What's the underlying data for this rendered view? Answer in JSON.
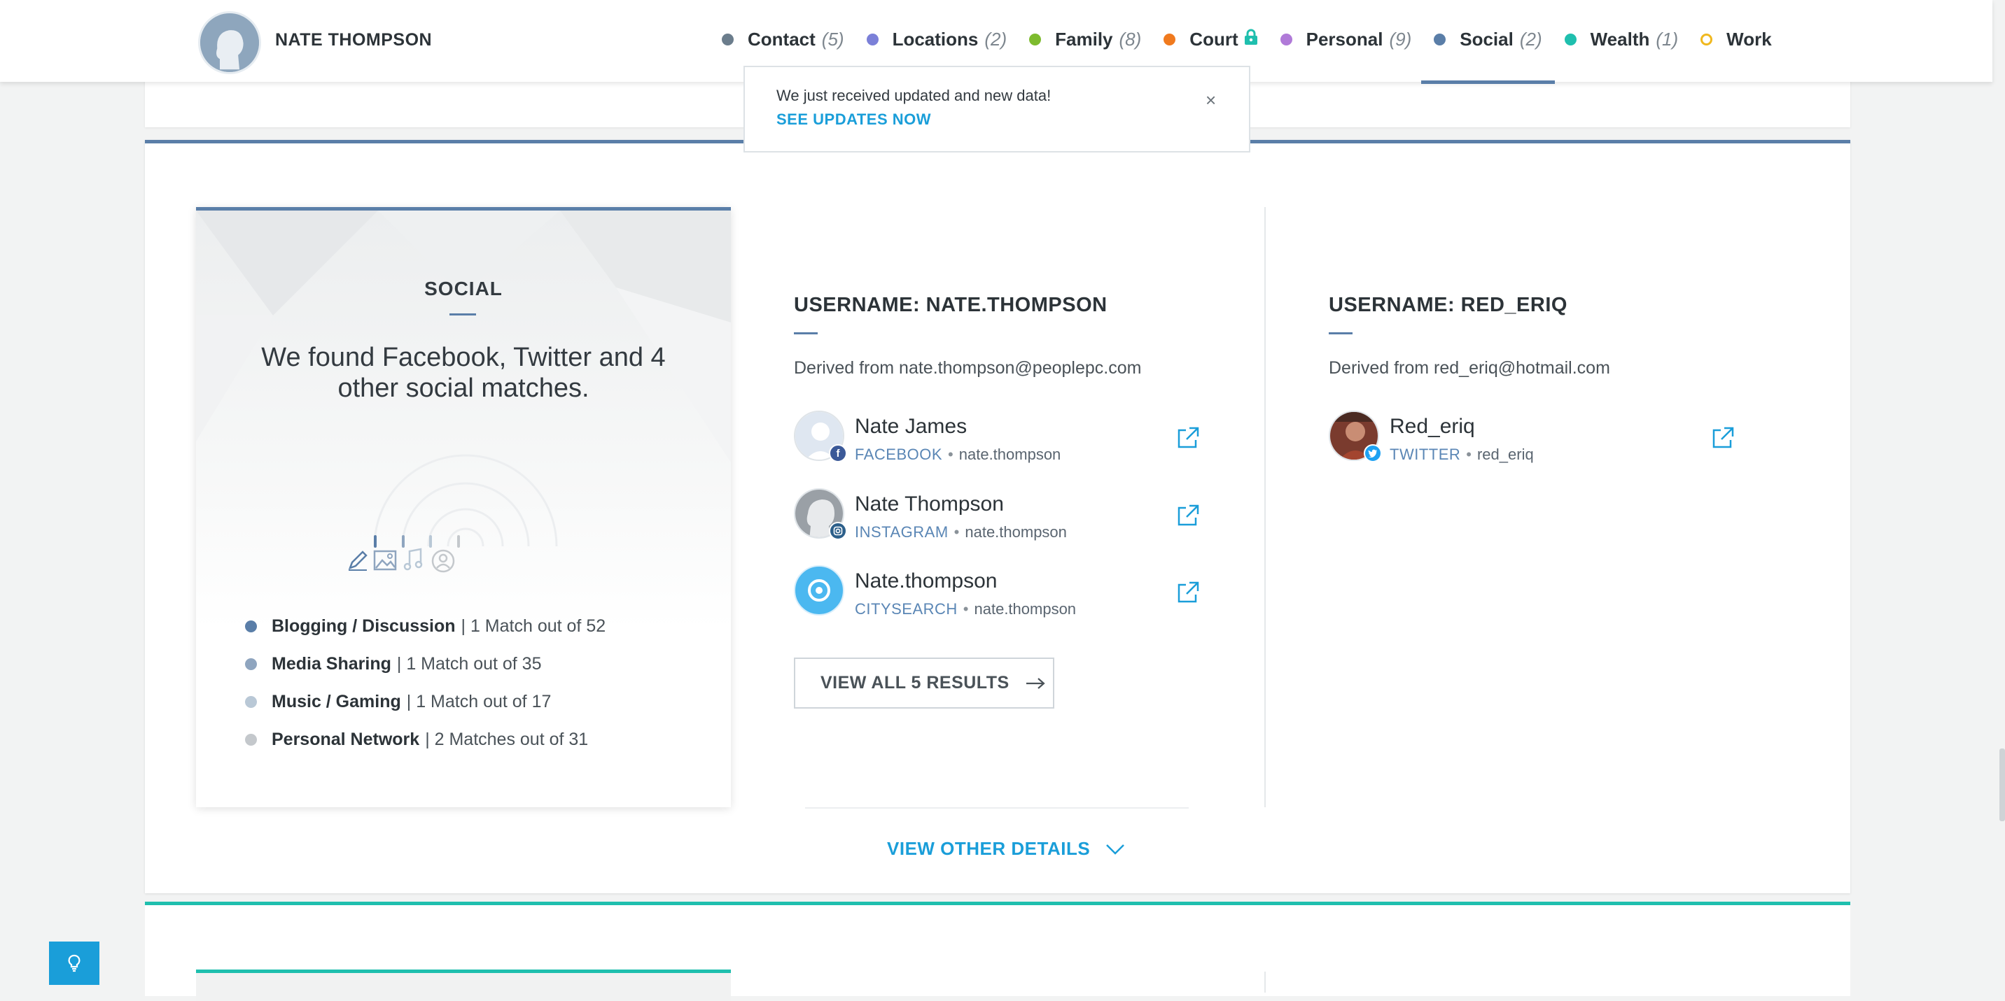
{
  "header": {
    "name": "NATE THOMPSON",
    "nav": [
      {
        "label": "Contact",
        "count": "(5)",
        "color": "#6b7d8c"
      },
      {
        "label": "Locations",
        "count": "(2)",
        "color": "#7b80d8"
      },
      {
        "label": "Family",
        "count": "(8)",
        "color": "#7dbb2e"
      },
      {
        "label": "Court",
        "count": "",
        "color": "#f07a1e",
        "lock": true
      },
      {
        "label": "Personal",
        "count": "(9)",
        "color": "#b07ad8"
      },
      {
        "label": "Social",
        "count": "(2)",
        "color": "#5a7ea8",
        "active": true
      },
      {
        "label": "Wealth",
        "count": "(1)",
        "color": "#1fbfae"
      },
      {
        "label": "Work",
        "count": "",
        "color": "#f0b81e",
        "hollow": true
      }
    ]
  },
  "toast": {
    "message": "We just received updated and new data!",
    "link": "SEE UPDATES NOW",
    "close": "×"
  },
  "summary": {
    "title": "SOCIAL",
    "headline": "We found Facebook, Twitter and 4 other social matches.",
    "categories": [
      {
        "name": "Blogging / Discussion",
        "stat": "| 1 Match out of 52",
        "color": "#5a7ea8"
      },
      {
        "name": "Media Sharing",
        "stat": "| 1 Match out of 35",
        "color": "#8fa5bf"
      },
      {
        "name": "Music / Gaming",
        "stat": "| 1 Match out of 17",
        "color": "#b9c8d6"
      },
      {
        "name": "Personal Network",
        "stat": "| 2 Matches out of 31",
        "color": "#c4c8cc"
      }
    ]
  },
  "columns": [
    {
      "title": "USERNAME: NATE.THOMPSON",
      "derived": "Derived from nate.thompson@peoplepc.com",
      "results": [
        {
          "name": "Nate James",
          "network": "FACEBOOK",
          "sep": "•",
          "username": "nate.thompson",
          "badge_color": "#3b5998",
          "badge_icon": "facebook-icon"
        },
        {
          "name": "Nate Thompson",
          "network": "INSTAGRAM",
          "sep": "•",
          "username": "nate.thompson",
          "badge_color": "#2c5f8a",
          "badge_icon": "instagram-icon"
        },
        {
          "name": "Nate.thompson",
          "network": "CITYSEARCH",
          "sep": "•",
          "username": "nate.thompson",
          "badge_color": "#4bb8f0",
          "badge_icon": "citysearch-icon"
        }
      ],
      "view_all": "VIEW ALL 5 RESULTS"
    },
    {
      "title": "USERNAME: RED_ERIQ",
      "derived": "Derived from red_eriq@hotmail.com",
      "results": [
        {
          "name": "Red_eriq",
          "network": "TWITTER",
          "sep": "•",
          "username": "red_eriq",
          "badge_color": "#1da1f2",
          "badge_icon": "twitter-icon"
        }
      ]
    }
  ],
  "view_other": "VIEW OTHER DETAILS",
  "colors": {
    "accent": "#5a7ea8",
    "link": "#1a9ed9",
    "wealth": "#1fbfae"
  }
}
